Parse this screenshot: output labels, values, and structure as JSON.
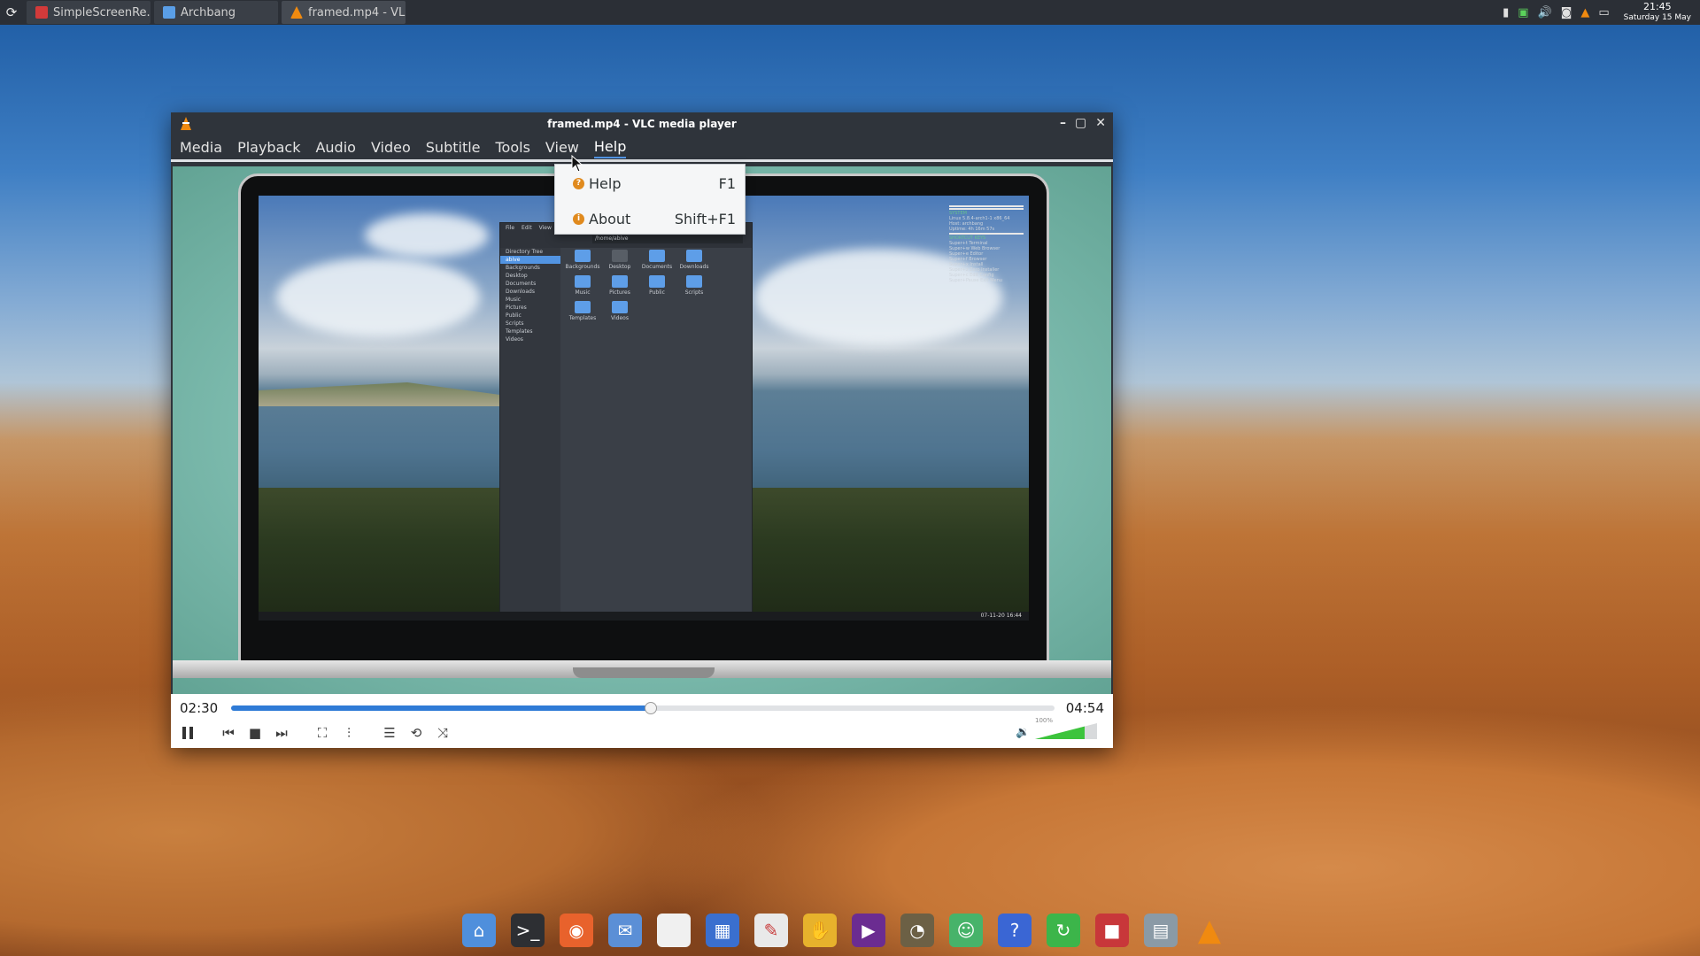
{
  "taskbar": {
    "tasks": [
      {
        "label": "SimpleScreenRe...",
        "icon": "record-icon",
        "color": "#d23a3a"
      },
      {
        "label": "Archbang",
        "icon": "folder-icon",
        "color": "#5a9ee6"
      },
      {
        "label": "framed.mp4 - VL...",
        "icon": "vlc-cone-icon",
        "color": "#f08a10"
      }
    ],
    "clock_time": "21:45",
    "clock_date": "Saturday 15 May"
  },
  "vlc": {
    "title": "framed.mp4 - VLC media player",
    "menus": [
      "Media",
      "Playback",
      "Audio",
      "Video",
      "Subtitle",
      "Tools",
      "View",
      "Help"
    ],
    "active_menu": "Help",
    "help_menu": [
      {
        "label": "Help",
        "shortcut": "F1"
      },
      {
        "label": "About",
        "shortcut": "Shift+F1"
      }
    ],
    "elapsed": "02:30",
    "total": "04:54",
    "progress": 0.51,
    "volume_label": "100%",
    "volume": 0.8,
    "accent": "#2f7bd6",
    "volume_color": "#3cc43c"
  },
  "video_frame": {
    "file_manager": {
      "menu": [
        "File",
        "Edit",
        "View"
      ],
      "path": "/home/abive",
      "sidebar_title": "Directory Tree",
      "sidebar": [
        "abive",
        "Backgrounds",
        "Desktop",
        "Documents",
        "Downloads",
        "Music",
        "Pictures",
        "Public",
        "Scripts",
        "Templates",
        "Videos"
      ],
      "folders": [
        "Backgrounds",
        "Desktop",
        "Documents",
        "Downloads",
        "Music",
        "Pictures",
        "Public",
        "Scripts",
        "Templates",
        "Videos"
      ]
    },
    "conky": [
      "SYSTEM",
      "Linux 5.8.4-arch1-1 x86_64",
      "Host: archbang",
      "Uptime: 4h 16m 57s",
      "SHORTCUT KEYS",
      "Super+t  Terminal",
      "Super+w  Web Browser",
      "Super+e  Editor",
      "Super+f  Browser",
      "Super+x  Install",
      "Super+z  Zero Installer",
      "Super+c  Edit Config",
      "Super+Pause  Exit Menu"
    ],
    "screen_clock": "07-11-20 16:44"
  },
  "dock": [
    {
      "name": "home-folder-icon",
      "color": "#4f8fdc",
      "glyph": "⌂"
    },
    {
      "name": "terminal-icon",
      "color": "#2d2f33",
      "glyph": ">_"
    },
    {
      "name": "firefox-icon",
      "color": "#e8622c",
      "glyph": "◉"
    },
    {
      "name": "mail-icon",
      "color": "#5b8fd6",
      "glyph": "✉"
    },
    {
      "name": "text-document-icon",
      "color": "#f0f0f0",
      "glyph": ""
    },
    {
      "name": "calculator-icon",
      "color": "#3a6fcf",
      "glyph": "▦"
    },
    {
      "name": "document-editor-icon",
      "color": "#e9e9e9",
      "glyph": "✎"
    },
    {
      "name": "package-icon",
      "color": "#e7b22c",
      "glyph": "✋"
    },
    {
      "name": "media-player-icon",
      "color": "#6b2c91",
      "glyph": "▶"
    },
    {
      "name": "gimp-icon",
      "color": "#6c6045",
      "glyph": "◔"
    },
    {
      "name": "ghost-icon",
      "color": "#47b36a",
      "glyph": "☺"
    },
    {
      "name": "help-icon",
      "color": "#3a66d4",
      "glyph": "?"
    },
    {
      "name": "update-icon",
      "color": "#3cb54a",
      "glyph": "↻"
    },
    {
      "name": "screen-recorder-icon",
      "color": "#c8373a",
      "glyph": "■"
    },
    {
      "name": "archive-manager-icon",
      "color": "#8a9aa6",
      "glyph": "▤"
    },
    {
      "name": "vlc-icon",
      "color": "#f08a10",
      "glyph": "▲"
    }
  ]
}
